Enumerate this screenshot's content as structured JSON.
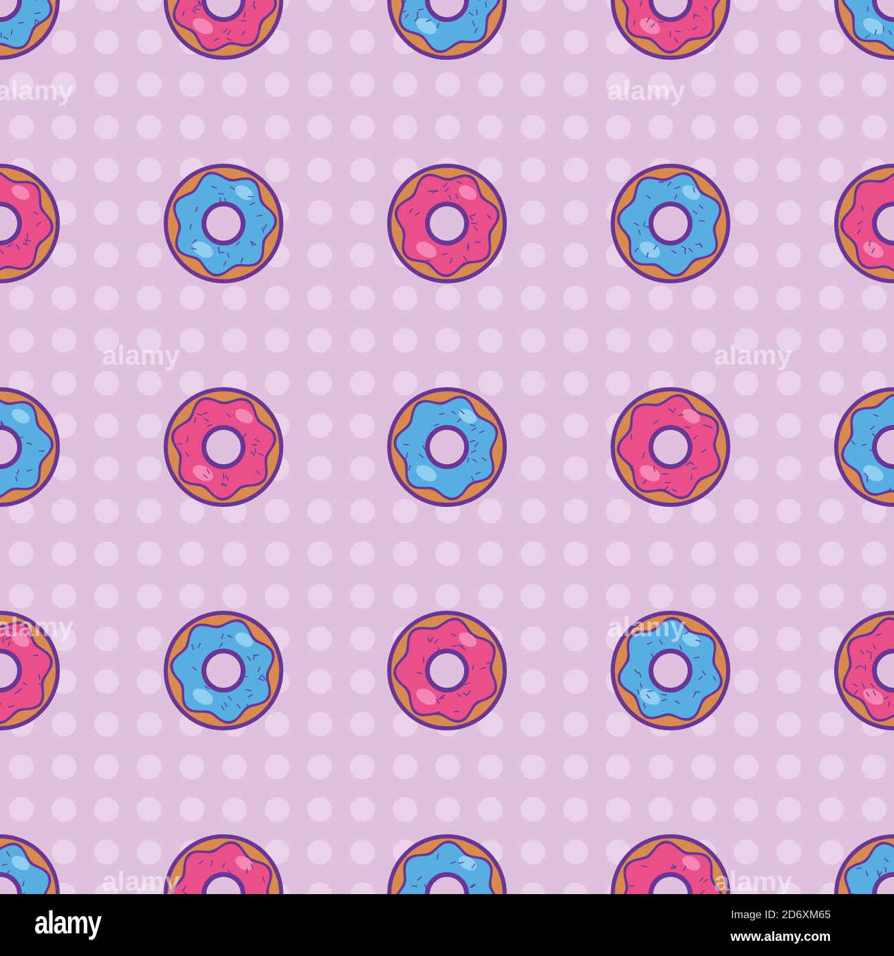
{
  "pattern": {
    "background_color": "#dfc1dd",
    "dot_color": "#e9d3ea",
    "outline_color": "#6a3696",
    "dough_color": "#d98a4e",
    "glaze_colors": {
      "blue": "#58aee2",
      "pink": "#e94f88"
    },
    "highlight_colors": {
      "blue": "#8fd0f2",
      "pink": "#f487b3"
    },
    "sprinkle_color": "#5a3a9a"
  },
  "watermark": "alamy",
  "footer": {
    "logo": "alamy",
    "image_id": "Image ID: 2D6XM65",
    "website": "www.alamy.com"
  }
}
